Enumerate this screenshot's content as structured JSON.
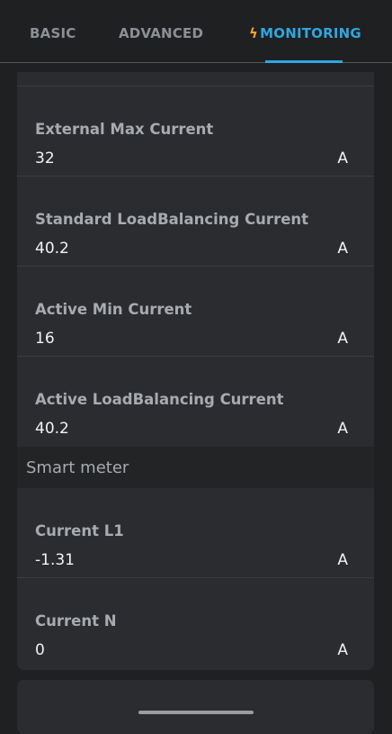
{
  "tabs": [
    {
      "label": "BASIC",
      "active": false
    },
    {
      "label": "ADVANCED",
      "active": false
    },
    {
      "label": "MONITORING",
      "active": true,
      "icon": "bolt-icon"
    }
  ],
  "colors": {
    "accent": "#2fa6e0",
    "bolt": "#f2a23a",
    "background": "#1f2022",
    "card": "#2b2c2f"
  },
  "fields_top": [
    {
      "label": "External Max Current",
      "value": "32",
      "unit": "A"
    },
    {
      "label": "Standard LoadBalancing Current",
      "value": "40.2",
      "unit": "A"
    },
    {
      "label": "Active Min Current",
      "value": "16",
      "unit": "A"
    },
    {
      "label": "Active LoadBalancing Current",
      "value": "40.2",
      "unit": "A"
    }
  ],
  "smart_meter": {
    "title": "Smart meter",
    "fields": [
      {
        "label": "Current L1",
        "value": "-1.31",
        "unit": "A"
      },
      {
        "label": "Current N",
        "value": "0",
        "unit": "A"
      }
    ]
  }
}
